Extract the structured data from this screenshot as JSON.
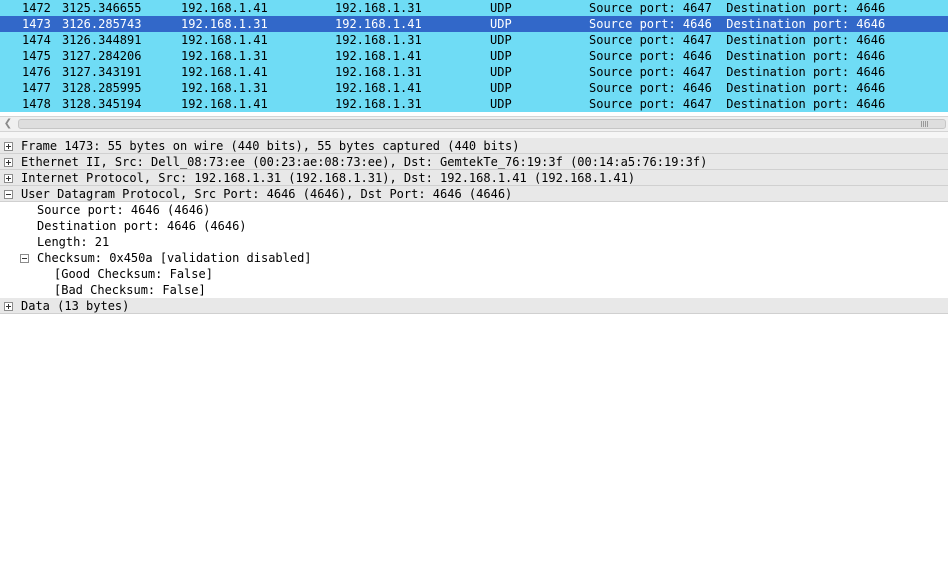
{
  "colors": {
    "row_udp": "#6fdcf5",
    "row_selected": "#3268c9",
    "row_selected_text": "#ffffff"
  },
  "packet_list": {
    "rows": [
      {
        "no": "1472",
        "time": "3125.346655",
        "src": "192.168.1.41",
        "dst": "192.168.1.31",
        "proto": "UDP",
        "info": "Source port: 4647  Destination port: 4646",
        "selected": false
      },
      {
        "no": "1473",
        "time": "3126.285743",
        "src": "192.168.1.31",
        "dst": "192.168.1.41",
        "proto": "UDP",
        "info": "Source port: 4646  Destination port: 4646",
        "selected": true
      },
      {
        "no": "1474",
        "time": "3126.344891",
        "src": "192.168.1.41",
        "dst": "192.168.1.31",
        "proto": "UDP",
        "info": "Source port: 4647  Destination port: 4646",
        "selected": false
      },
      {
        "no": "1475",
        "time": "3127.284206",
        "src": "192.168.1.31",
        "dst": "192.168.1.41",
        "proto": "UDP",
        "info": "Source port: 4646  Destination port: 4646",
        "selected": false
      },
      {
        "no": "1476",
        "time": "3127.343191",
        "src": "192.168.1.41",
        "dst": "192.168.1.31",
        "proto": "UDP",
        "info": "Source port: 4647  Destination port: 4646",
        "selected": false
      },
      {
        "no": "1477",
        "time": "3128.285995",
        "src": "192.168.1.31",
        "dst": "192.168.1.41",
        "proto": "UDP",
        "info": "Source port: 4646  Destination port: 4646",
        "selected": false
      },
      {
        "no": "1478",
        "time": "3128.345194",
        "src": "192.168.1.41",
        "dst": "192.168.1.31",
        "proto": "UDP",
        "info": "Source port: 4647  Destination port: 4646",
        "selected": false
      }
    ]
  },
  "scrollbar": {
    "left_arrow_icon": "chevron-left-icon"
  },
  "details": {
    "items": [
      {
        "text": "Frame 1473: 55 bytes on wire (440 bits), 55 bytes captured (440 bits)",
        "level": 0,
        "toggle": "plus",
        "top": true
      },
      {
        "text": "Ethernet II, Src: Dell_08:73:ee (00:23:ae:08:73:ee), Dst: GemtekTe_76:19:3f (00:14:a5:76:19:3f)",
        "level": 0,
        "toggle": "plus",
        "top": true
      },
      {
        "text": "Internet Protocol, Src: 192.168.1.31 (192.168.1.31), Dst: 192.168.1.41 (192.168.1.41)",
        "level": 0,
        "toggle": "plus",
        "top": true
      },
      {
        "text": "User Datagram Protocol, Src Port: 4646 (4646), Dst Port: 4646 (4646)",
        "level": 0,
        "toggle": "minus",
        "top": true
      },
      {
        "text": "Source port: 4646 (4646)",
        "level": 1,
        "toggle": "",
        "top": false
      },
      {
        "text": "Destination port: 4646 (4646)",
        "level": 1,
        "toggle": "",
        "top": false
      },
      {
        "text": "Length: 21",
        "level": 1,
        "toggle": "",
        "top": false
      },
      {
        "text": "Checksum: 0x450a [validation disabled]",
        "level": 1,
        "toggle": "minus",
        "top": false
      },
      {
        "text": "[Good Checksum: False]",
        "level": 2,
        "toggle": "",
        "top": false
      },
      {
        "text": "[Bad Checksum: False]",
        "level": 2,
        "toggle": "",
        "top": false
      },
      {
        "text": "Data (13 bytes)",
        "level": 0,
        "toggle": "plus",
        "top": true
      }
    ]
  }
}
